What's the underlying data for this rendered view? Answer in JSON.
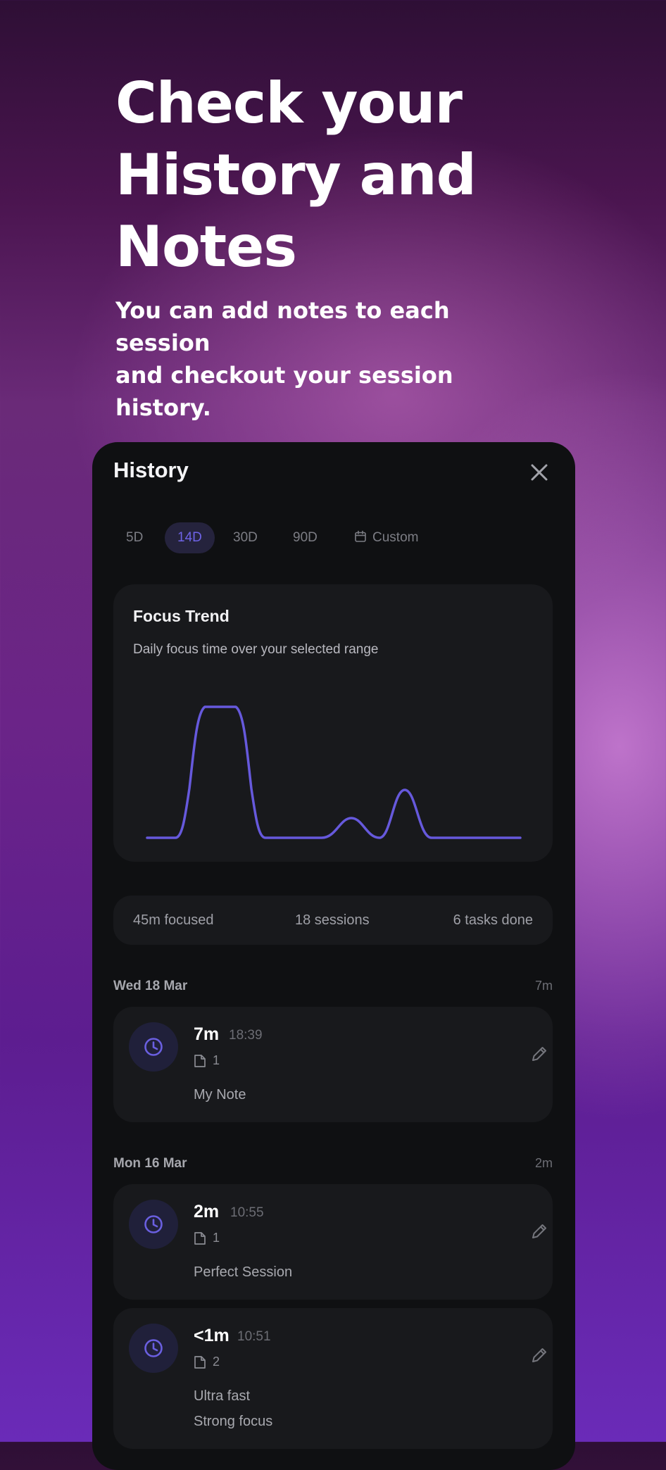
{
  "hero": {
    "title_lines": [
      "Check your",
      "History and",
      "Notes"
    ],
    "subtitle_lines": [
      "You can add notes to each session",
      "and checkout your session",
      "history."
    ]
  },
  "panel": {
    "title": "History",
    "close_icon": "close-icon",
    "range_tabs": [
      {
        "label": "5D",
        "active": false
      },
      {
        "label": "14D",
        "active": true
      },
      {
        "label": "30D",
        "active": false
      },
      {
        "label": "90D",
        "active": false
      },
      {
        "label": "Custom",
        "active": false,
        "icon": "calendar-icon"
      }
    ],
    "accent_color": "#6e63e6",
    "trend": {
      "title": "Focus Trend",
      "description": "Daily focus time over your selected range"
    },
    "stats": {
      "focused": "45m focused",
      "sessions": "18 sessions",
      "tasks": "6 tasks done"
    },
    "days": [
      {
        "label": "Wed 18 Mar",
        "total": "7m",
        "sessions": [
          {
            "duration": "7m",
            "time": "18:39",
            "note_count": "1",
            "notes": [
              "My Note"
            ],
            "icon": "clock-icon"
          }
        ]
      },
      {
        "label": "Mon 16 Mar",
        "total": "2m",
        "sessions": [
          {
            "duration": "2m",
            "time": "10:55",
            "note_count": "1",
            "notes": [
              "Perfect Session"
            ],
            "icon": "clock-icon"
          },
          {
            "duration": "<1m",
            "time": "10:51",
            "note_count": "2",
            "notes": [
              "Ultra fast",
              "Strong focus"
            ],
            "icon": "clock-icon"
          }
        ]
      }
    ]
  }
}
